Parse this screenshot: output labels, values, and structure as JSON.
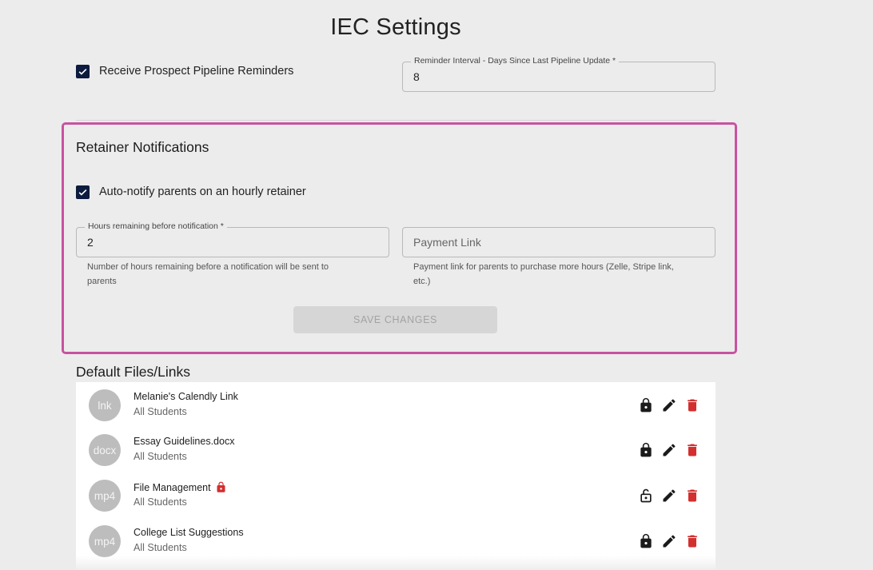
{
  "page": {
    "title": "IEC Settings"
  },
  "pipeline": {
    "reminders_label": "Receive Prospect Pipeline Reminders",
    "reminders_checked": true,
    "interval_label": "Reminder Interval - Days Since Last Pipeline Update *",
    "interval_value": "8"
  },
  "retainer": {
    "title": "Retainer Notifications",
    "auto_notify_label": "Auto-notify parents on an hourly retainer",
    "auto_notify_checked": true,
    "hours_label": "Hours remaining before notification *",
    "hours_value": "2",
    "hours_helper_line1": "Number of hours remaining before a notification will be sent to",
    "hours_helper_line2": "parents",
    "payment_placeholder": "Payment Link",
    "payment_helper_line1": "Payment link for parents to purchase more hours (Zelle, Stripe link,",
    "payment_helper_line2": "etc.)",
    "save_label": "SAVE CHANGES"
  },
  "files": {
    "title": "Default Files/Links",
    "items": [
      {
        "avatar": "lnk",
        "name": "Melanie's Calendly Link",
        "audience": "All Students",
        "locked": true,
        "name_lock": false
      },
      {
        "avatar": "docx",
        "name": "Essay Guidelines.docx",
        "audience": "All Students",
        "locked": true,
        "name_lock": false
      },
      {
        "avatar": "mp4",
        "name": "File Management",
        "audience": "All Students",
        "locked": false,
        "name_lock": true
      },
      {
        "avatar": "mp4",
        "name": "College List Suggestions",
        "audience": "All Students",
        "locked": true,
        "name_lock": false
      }
    ]
  },
  "colors": {
    "highlight_border": "#c9529f",
    "checkbox": "#0d1b3e",
    "delete_icon": "#d32f2f",
    "name_lock_icon": "#d32f2f"
  }
}
